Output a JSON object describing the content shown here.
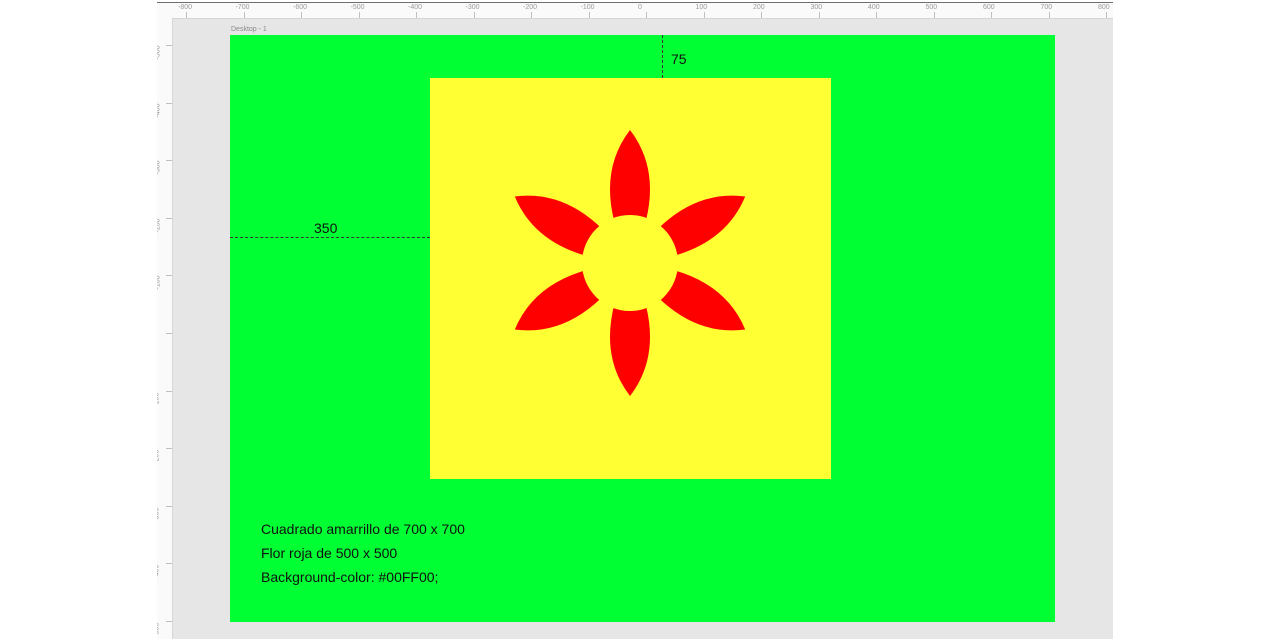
{
  "artboard": {
    "label": "Desktop - 1",
    "background": "#00FF33"
  },
  "rulers": {
    "horizontal": [
      "-800",
      "-700",
      "-600",
      "-500",
      "-400",
      "-300",
      "-200",
      "-100",
      "0",
      "100",
      "200",
      "300",
      "400",
      "500",
      "600",
      "700",
      "800"
    ],
    "vertical": [
      "-500",
      "-400",
      "-300",
      "-200",
      "-100",
      "0",
      "100",
      "200",
      "300",
      "400",
      "500"
    ]
  },
  "dimensions": {
    "top_offset": "75",
    "left_offset": "350"
  },
  "shapes": {
    "square_color": "#FFFF33",
    "flower_color": "#FF0000"
  },
  "notes": [
    "Cuadrado amarrillo de 700 x 700",
    "Flor roja de 500 x 500",
    "Background-color: #00FF00;"
  ]
}
